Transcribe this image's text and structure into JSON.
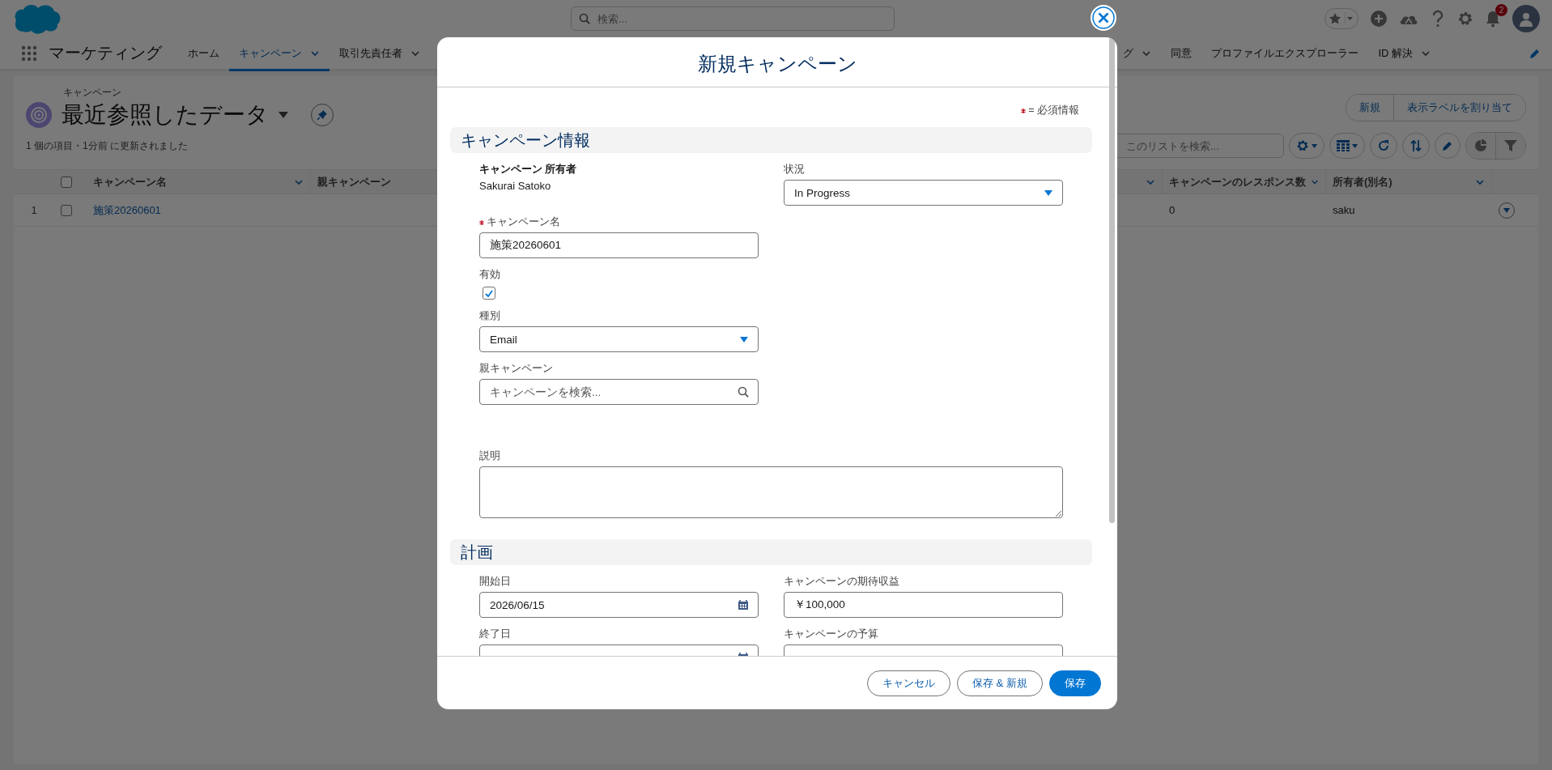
{
  "top_bar": {
    "search_placeholder": "検索...",
    "notification_count": "2"
  },
  "nav": {
    "app_name": "マーケティング",
    "left_items": [
      {
        "label": "ホーム",
        "selected": false,
        "has_menu": false
      },
      {
        "label": "キャンペーン",
        "selected": true,
        "has_menu": true
      },
      {
        "label": "取引先責任者",
        "selected": false,
        "has_menu": true
      }
    ],
    "right_items": [
      {
        "label": "グ",
        "selected": false,
        "has_menu": true
      },
      {
        "label": "同意",
        "selected": false,
        "has_menu": false
      },
      {
        "label": "プロファイルエクスプローラー",
        "selected": false,
        "has_menu": false
      },
      {
        "label": "ID 解決",
        "selected": false,
        "has_menu": true
      }
    ]
  },
  "list_view": {
    "object_label": "キャンペーン",
    "title": "最近参照したデータ",
    "buttons": [
      "新規",
      "表示ラベルを割り当て"
    ],
    "status": "1 個の項目・1分前 に更新されました",
    "search_placeholder": "このリストを検索...",
    "all_selected": false,
    "columns": [
      {
        "label": "キャンペーン名",
        "has_menu": true
      },
      {
        "label": "親キャンペーン",
        "has_menu": false
      },
      {
        "has_menu": true
      },
      {
        "label": "キャンペーンのレスポンス数",
        "has_menu": true
      },
      {
        "label": "所有者(別名)",
        "has_menu": true
      }
    ],
    "rows": [
      {
        "number": "1",
        "selected": false,
        "name": "施策20260601",
        "responses": "0",
        "owner": "saku"
      }
    ]
  },
  "modal": {
    "title": "新規キャンペーン",
    "required_note": "= 必須情報",
    "sections": [
      {
        "title": "キャンペーン情報",
        "rows": [
          [
            {
              "kind": "readonly",
              "label": "キャンペーン 所有者",
              "value": "Sakurai Satoko",
              "required": false
            },
            {
              "kind": "select",
              "label": "状況",
              "value": "In Progress",
              "required": false
            }
          ],
          [
            {
              "kind": "text",
              "label": "キャンペーン名",
              "value": "施策20260601",
              "required": true
            }
          ],
          [
            {
              "kind": "checkbox",
              "label": "有効",
              "checked": true,
              "required": false
            }
          ],
          [
            {
              "kind": "select",
              "label": "種別",
              "value": "Email",
              "required": false
            }
          ],
          [
            {
              "kind": "lookup",
              "label": "親キャンペーン",
              "placeholder": "キャンペーンを検索...",
              "required": false
            }
          ],
          [
            {
              "kind": "textarea",
              "label": "説明",
              "required": false
            }
          ]
        ]
      },
      {
        "title": "計画",
        "rows": [
          [
            {
              "kind": "date",
              "label": "開始日",
              "value": "2026/06/15",
              "required": false
            },
            {
              "kind": "text",
              "label": "キャンペーンの期待収益",
              "value": "￥100,000",
              "required": false
            }
          ],
          [
            {
              "kind": "date",
              "label": "終了日",
              "required": false
            },
            {
              "kind": "text",
              "label": "キャンペーンの予算",
              "required": false
            }
          ]
        ]
      }
    ],
    "buttons": [
      {
        "label": "キャンセル",
        "kind": "neutral"
      },
      {
        "label": "保存 & 新規",
        "kind": "neutral"
      },
      {
        "label": "保存",
        "kind": "brand"
      }
    ]
  }
}
